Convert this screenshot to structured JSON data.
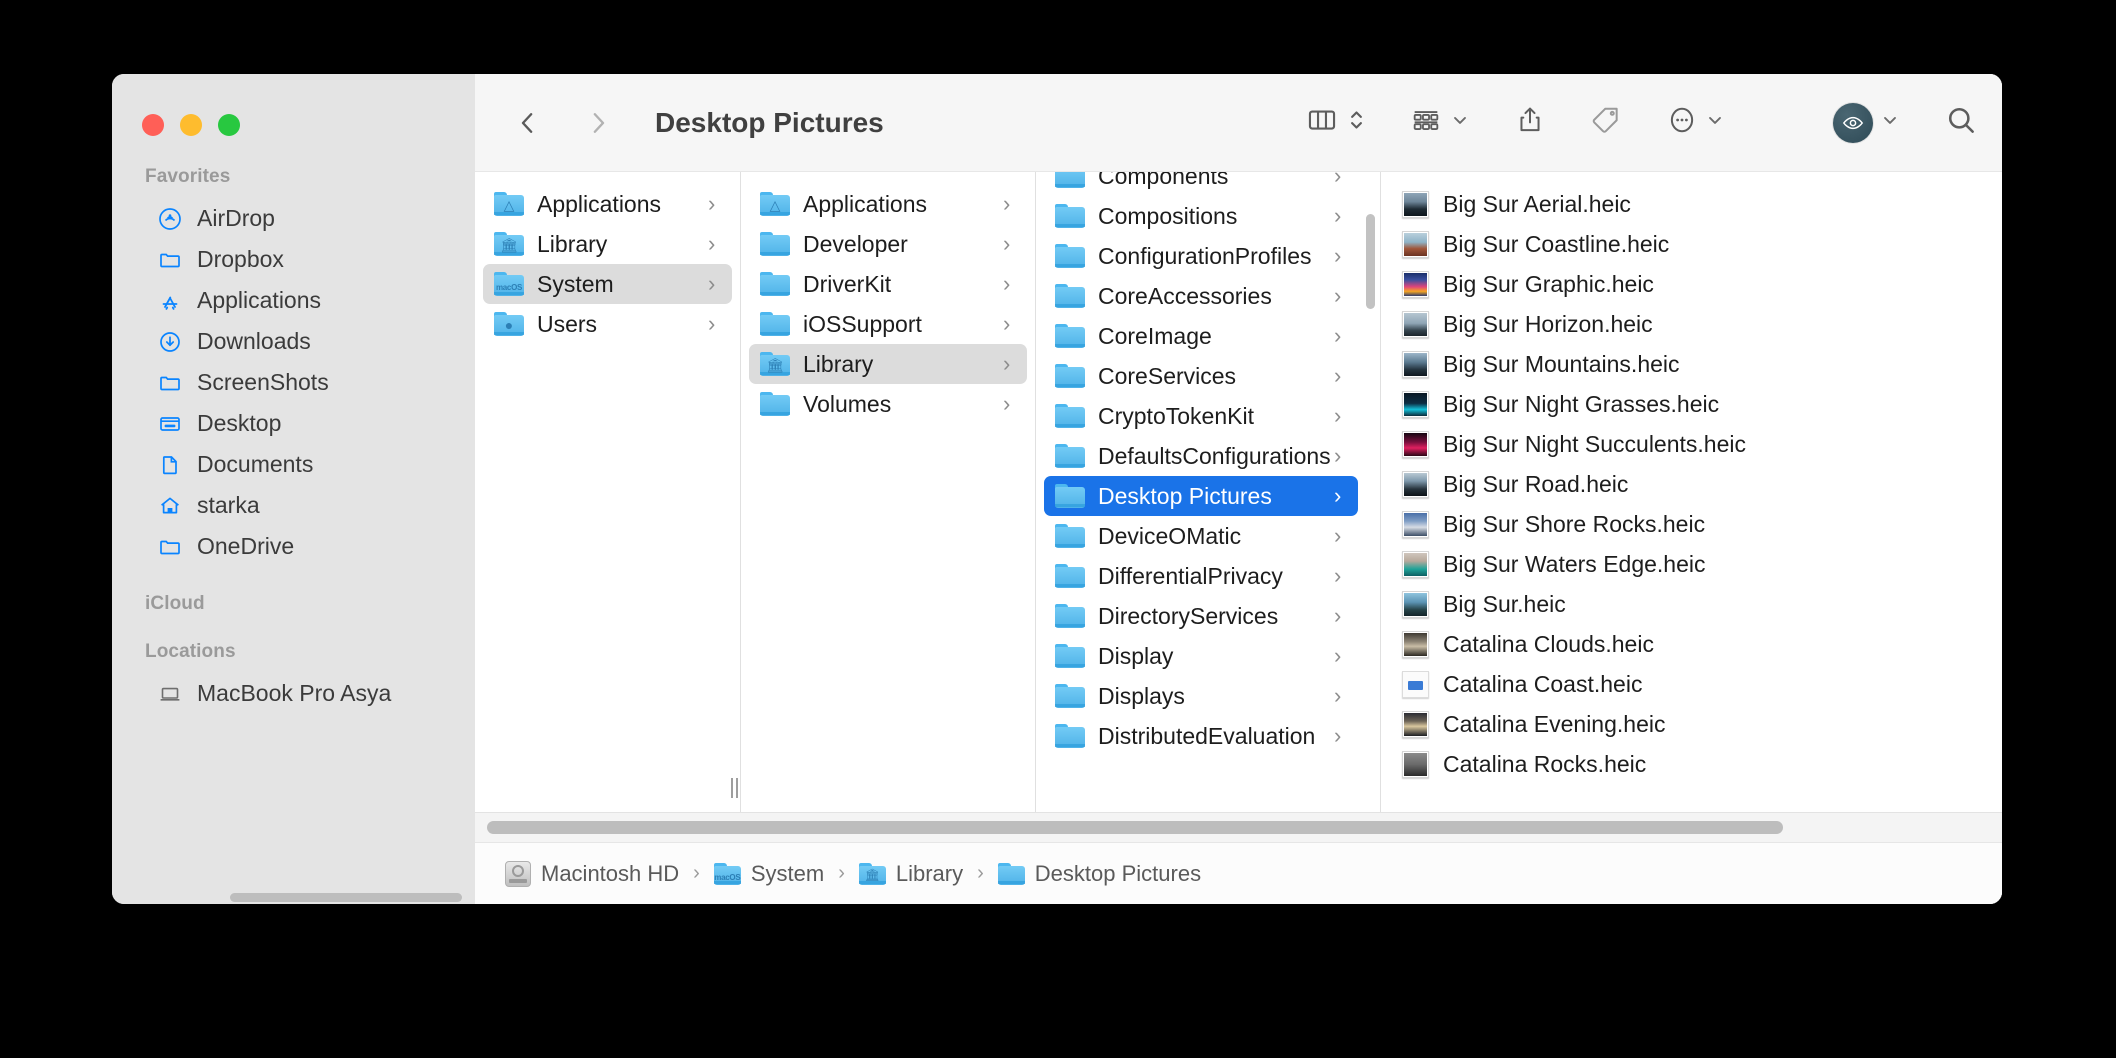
{
  "window": {
    "title": "Desktop Pictures",
    "traffic_lights": [
      "close",
      "minimize",
      "maximize"
    ]
  },
  "toolbar": {
    "back_icon": "chevron-left-icon",
    "forward_icon": "chevron-right-icon",
    "title": "Desktop Pictures",
    "view_column_icon": "column-view-icon",
    "view_stepper_icon": "up-down-chevron-icon",
    "group_icon": "group-by-icon",
    "share_icon": "share-icon",
    "tag_icon": "tag-icon",
    "more_icon": "ellipsis-circle-icon",
    "quicklook_icon": "eye-icon",
    "search_icon": "search-icon"
  },
  "sidebar": {
    "sections": [
      {
        "label": "Favorites",
        "items": [
          {
            "label": "AirDrop",
            "icon": "airdrop-icon"
          },
          {
            "label": "Dropbox",
            "icon": "folder-icon"
          },
          {
            "label": "Applications",
            "icon": "app-store-icon"
          },
          {
            "label": "Downloads",
            "icon": "download-circle-icon"
          },
          {
            "label": "ScreenShots",
            "icon": "folder-icon"
          },
          {
            "label": "Desktop",
            "icon": "desktop-icon"
          },
          {
            "label": "Documents",
            "icon": "document-icon"
          },
          {
            "label": "starka",
            "icon": "home-icon"
          },
          {
            "label": "OneDrive",
            "icon": "folder-icon"
          }
        ]
      },
      {
        "label": "iCloud",
        "items": []
      },
      {
        "label": "Locations",
        "items": [
          {
            "label": "MacBook Pro Asya",
            "icon": "laptop-icon"
          }
        ]
      }
    ]
  },
  "columns": [
    {
      "name": "column-1",
      "items": [
        {
          "label": "Applications",
          "icon": "folder-appstore-icon",
          "chevron": true,
          "selected": false
        },
        {
          "label": "Library",
          "icon": "folder-library-icon",
          "chevron": true,
          "selected": false
        },
        {
          "label": "System",
          "icon": "folder-macos-icon",
          "chevron": true,
          "selected": "gray"
        },
        {
          "label": "Users",
          "icon": "folder-users-icon",
          "chevron": true,
          "selected": false
        }
      ]
    },
    {
      "name": "column-2",
      "items": [
        {
          "label": "Applications",
          "icon": "folder-appstore-icon",
          "chevron": true,
          "selected": false
        },
        {
          "label": "Developer",
          "icon": "folder-icon",
          "chevron": true,
          "selected": false
        },
        {
          "label": "DriverKit",
          "icon": "folder-icon",
          "chevron": true,
          "selected": false
        },
        {
          "label": "iOSSupport",
          "icon": "folder-icon",
          "chevron": true,
          "selected": false
        },
        {
          "label": "Library",
          "icon": "folder-library-icon",
          "chevron": true,
          "selected": "gray"
        },
        {
          "label": "Volumes",
          "icon": "folder-icon",
          "chevron": true,
          "selected": false
        }
      ]
    },
    {
      "name": "column-3",
      "items": [
        {
          "label": "Components",
          "icon": "folder-icon",
          "chevron": true,
          "selected": false
        },
        {
          "label": "Compositions",
          "icon": "folder-icon",
          "chevron": true,
          "selected": false
        },
        {
          "label": "ConfigurationProfiles",
          "icon": "folder-icon",
          "chevron": true,
          "selected": false
        },
        {
          "label": "CoreAccessories",
          "icon": "folder-icon",
          "chevron": true,
          "selected": false
        },
        {
          "label": "CoreImage",
          "icon": "folder-icon",
          "chevron": true,
          "selected": false
        },
        {
          "label": "CoreServices",
          "icon": "folder-icon",
          "chevron": true,
          "selected": false
        },
        {
          "label": "CryptoTokenKit",
          "icon": "folder-icon",
          "chevron": true,
          "selected": false
        },
        {
          "label": "DefaultsConfigurations",
          "icon": "folder-icon",
          "chevron": true,
          "selected": false
        },
        {
          "label": "Desktop Pictures",
          "icon": "folder-icon",
          "chevron": true,
          "selected": "blue"
        },
        {
          "label": "DeviceOMatic",
          "icon": "folder-icon",
          "chevron": true,
          "selected": false
        },
        {
          "label": "DifferentialPrivacy",
          "icon": "folder-icon",
          "chevron": true,
          "selected": false
        },
        {
          "label": "DirectoryServices",
          "icon": "folder-icon",
          "chevron": true,
          "selected": false
        },
        {
          "label": "Display",
          "icon": "folder-icon",
          "chevron": true,
          "selected": false
        },
        {
          "label": "Displays",
          "icon": "folder-icon",
          "chevron": true,
          "selected": false
        },
        {
          "label": "DistributedEvaluation",
          "icon": "folder-icon",
          "chevron": true,
          "selected": false
        }
      ]
    },
    {
      "name": "column-4",
      "items": [
        {
          "label": "Big Sur Aerial.heic",
          "icon": "image-thumbnail",
          "thumb": "linear-gradient(#8fa6b8 0%, #6d8598 38%, #1d2a33 70%, #0d161c 100%)"
        },
        {
          "label": "Big Sur Coastline.heic",
          "icon": "image-thumbnail",
          "thumb": "linear-gradient(#b9cfdc 0%, #8fb3c6 40%, #a0563a 68%, #6b3322 100%)"
        },
        {
          "label": "Big Sur Graphic.heic",
          "icon": "image-thumbnail",
          "thumb": "linear-gradient(#1a2f6b 0%, #3a4f9e 30%, #e0457b 60%, #f5a623 80%, #2d3a6e 100%)"
        },
        {
          "label": "Big Sur Horizon.heic",
          "icon": "image-thumbnail",
          "thumb": "linear-gradient(#b6c6d1 0%, #8fa5b5 45%, #36454f 75%, #1b242b 100%)"
        },
        {
          "label": "Big Sur Mountains.heic",
          "icon": "image-thumbnail",
          "thumb": "linear-gradient(#9db6c9 0%, #5b7a90 40%, #24343f 72%, #0f1820 100%)"
        },
        {
          "label": "Big Sur Night Grasses.heic",
          "icon": "image-thumbnail",
          "thumb": "linear-gradient(#0a1824 0%, #0d2e44 45%, #13c0d8 72%, #0b2a3a 100%)"
        },
        {
          "label": "Big Sur Night Succulents.heic",
          "icon": "image-thumbnail",
          "thumb": "linear-gradient(#160612 0%, #7a0f3d 40%, #e02060 65%, #2a0716 100%)"
        },
        {
          "label": "Big Sur Road.heic",
          "icon": "image-thumbnail",
          "thumb": "linear-gradient(#b9c9d4 0%, #7e98ab 35%, #26333c 70%, #0c1217 100%)"
        },
        {
          "label": "Big Sur Shore Rocks.heic",
          "icon": "image-thumbnail",
          "thumb": "linear-gradient(#4a6fa8 0%, #7f9dc4 35%, #d7dce4 62%, #3c4e66 100%)"
        },
        {
          "label": "Big Sur Waters Edge.heic",
          "icon": "image-thumbnail",
          "thumb": "linear-gradient(#cfc6bd 0%, #b7a99c 35%, #1fa398 70%, #0d5f63 100%)"
        },
        {
          "label": "Big Sur.heic",
          "icon": "image-thumbnail",
          "thumb": "linear-gradient(#8fc4de 0%, #5c94b4 40%, #27454a 72%, #13252a 100%)"
        },
        {
          "label": "Catalina Clouds.heic",
          "icon": "image-thumbnail",
          "thumb": "linear-gradient(#3e3a33 0%, #8d8475 38%, #c9bda6 58%, #2b2822 100%)"
        },
        {
          "label": "Catalina Coast.heic",
          "icon": "generic-file-icon",
          "thumb": ""
        },
        {
          "label": "Catalina Evening.heic",
          "icon": "image-thumbnail",
          "thumb": "linear-gradient(#2b2c33 0%, #6b6356 35%, #d9c79e 58%, #1b1d22 100%)"
        },
        {
          "label": "Catalina Rocks.heic",
          "icon": "image-thumbnail",
          "thumb": "linear-gradient(#8b8b8b 0%, #6a6a6a 50%, #2a2a2a 100%)"
        }
      ]
    }
  ],
  "pathbar": {
    "crumbs": [
      {
        "label": "Macintosh HD",
        "icon": "hard-disk-icon"
      },
      {
        "label": "System",
        "icon": "folder-macos-icon"
      },
      {
        "label": "Library",
        "icon": "folder-library-icon"
      },
      {
        "label": "Desktop Pictures",
        "icon": "folder-icon"
      }
    ],
    "separator": "›"
  },
  "colors": {
    "accent": "#1a73e8",
    "folder": "#4cb7ef",
    "sidebar_bg": "#e4e4e4",
    "toolbar_bg": "#f6f6f6"
  }
}
